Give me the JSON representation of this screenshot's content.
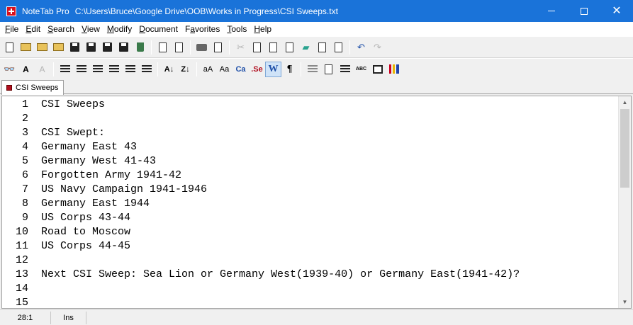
{
  "window": {
    "app_name": "NoteTab Pro",
    "file_path": "C:\\Users\\Bruce\\Google Drive\\OOB\\Works in Progress\\CSI Sweeps.txt"
  },
  "menu": [
    {
      "label": "File",
      "key": "F",
      "rest": "ile"
    },
    {
      "label": "Edit",
      "key": "E",
      "rest": "dit"
    },
    {
      "label": "Search",
      "key": "S",
      "rest": "earch"
    },
    {
      "label": "View",
      "key": "V",
      "rest": "iew"
    },
    {
      "label": "Modify",
      "key": "M",
      "rest": "odify"
    },
    {
      "label": "Document",
      "key": "D",
      "rest": "ocument"
    },
    {
      "label": "Favorites",
      "key": "a",
      "pre": "F",
      "rest": "vorites"
    },
    {
      "label": "Tools",
      "key": "T",
      "rest": "ools"
    },
    {
      "label": "Help",
      "key": "H",
      "rest": "elp"
    }
  ],
  "toolbar2_text": {
    "small_caps": "Ca",
    "sentence": ".Se",
    "word_wrap": "W",
    "pilcrow": "¶",
    "spell": "ABC"
  },
  "tabs": [
    {
      "label": "CSI Sweeps"
    }
  ],
  "editor": {
    "lines": [
      {
        "n": "1",
        "text": "CSI Sweeps"
      },
      {
        "n": "2",
        "text": ""
      },
      {
        "n": "3",
        "text": "CSI Swept:"
      },
      {
        "n": "4",
        "text": "Germany East 43"
      },
      {
        "n": "5",
        "text": "Germany West 41-43"
      },
      {
        "n": "6",
        "text": "Forgotten Army 1941-42"
      },
      {
        "n": "7",
        "text": "US Navy Campaign 1941-1946"
      },
      {
        "n": "8",
        "text": "Germany East 1944"
      },
      {
        "n": "9",
        "text": "US Corps 43-44"
      },
      {
        "n": "10",
        "text": "Road to Moscow"
      },
      {
        "n": "11",
        "text": "US Corps 44-45"
      },
      {
        "n": "12",
        "text": ""
      },
      {
        "n": "13",
        "text": "Next CSI Sweep: Sea Lion or Germany West(1939-40) or Germany East(1941-42)?"
      },
      {
        "n": "14",
        "text": ""
      },
      {
        "n": "15",
        "text": ""
      }
    ]
  },
  "status": {
    "position": "28:1",
    "mode": "Ins"
  },
  "colors": {
    "titlebar": "#1a73d9",
    "icon_red": "#d9101d"
  }
}
